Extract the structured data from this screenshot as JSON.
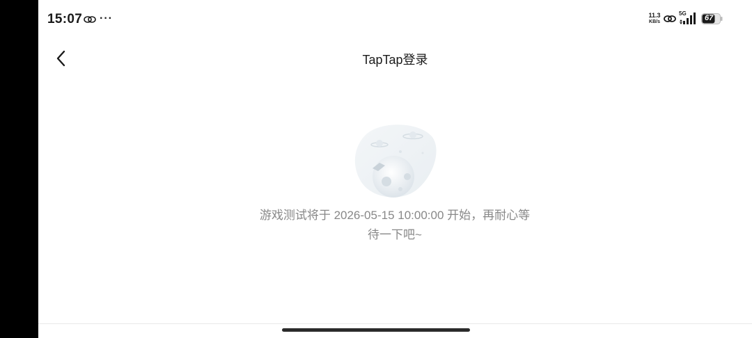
{
  "status_bar": {
    "time": "15:07",
    "more": "···",
    "net_speed_value": "11.3",
    "net_speed_unit": "KB/s",
    "network_type": "5G",
    "battery_level": "67"
  },
  "header": {
    "title": "TapTap登录"
  },
  "empty_state": {
    "message": "游戏测试将于 2026-05-15 10:00:00 开始，再耐心等待一下吧~",
    "illustration_icon": "planet-icon"
  },
  "colors": {
    "background": "#ffffff",
    "text_primary": "#1a1a1a",
    "text_secondary": "#888888"
  }
}
